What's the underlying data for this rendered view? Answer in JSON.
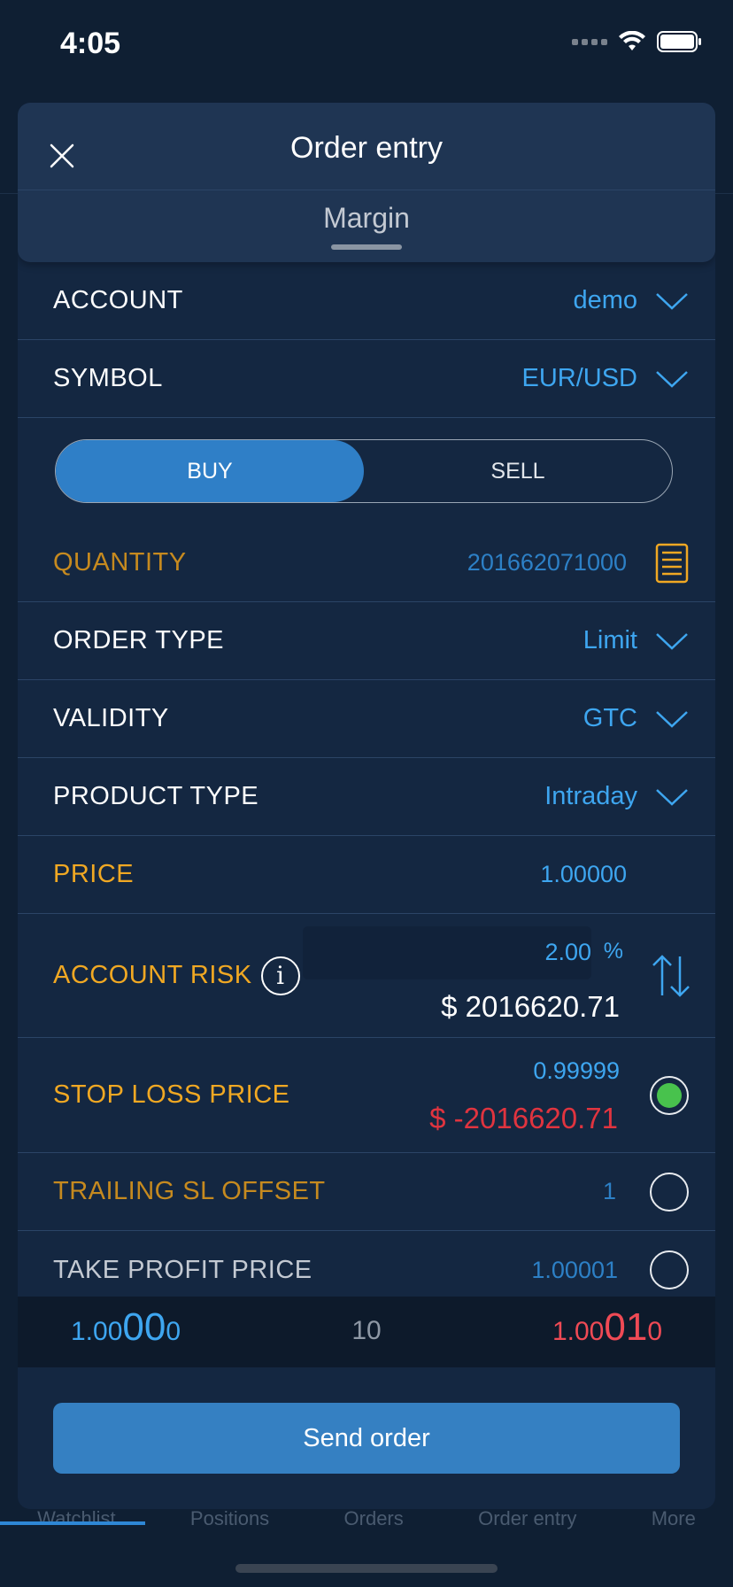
{
  "status": {
    "time": "4:05"
  },
  "background_tabs": [
    "Watchlist",
    "Positions",
    "Orders",
    "Order entry",
    "More"
  ],
  "header": {
    "title": "Order entry",
    "subtitle_tab": "Margin"
  },
  "account": {
    "label": "ACCOUNT",
    "value": "demo"
  },
  "symbol": {
    "label": "SYMBOL",
    "value": "EUR/USD"
  },
  "side": {
    "buy": "BUY",
    "sell": "SELL",
    "selected": "BUY"
  },
  "quantity": {
    "label": "QUANTITY",
    "value": "201662071000"
  },
  "order_type": {
    "label": "ORDER TYPE",
    "value": "Limit"
  },
  "validity": {
    "label": "VALIDITY",
    "value": "GTC"
  },
  "product_type": {
    "label": "PRODUCT TYPE",
    "value": "Intraday"
  },
  "price": {
    "label": "PRICE",
    "value": "1.00000"
  },
  "account_risk": {
    "label": "ACCOUNT RISK",
    "info": "i",
    "percent": "2.00",
    "percent_unit": "%",
    "amount": "$ 2016620.71"
  },
  "stop_loss": {
    "label": "STOP LOSS PRICE",
    "price": "0.99999",
    "amount": "$ -2016620.71",
    "selected": true
  },
  "trailing_sl": {
    "label": "TRAILING SL OFFSET",
    "value": "1"
  },
  "take_profit": {
    "label": "TAKE PROFIT PRICE",
    "value": "1.00001"
  },
  "quote": {
    "bid_prefix": "1.00",
    "bid_big": "00",
    "bid_suffix": "0",
    "spread": "10",
    "ask_prefix": "1.00",
    "ask_big": "01",
    "ask_suffix": "0"
  },
  "send_button": "Send order",
  "colors": {
    "accent": "#2f7fc7",
    "gold": "#f0a823",
    "negative": "#e0343f",
    "value_blue": "#3ea6f0",
    "radio_on": "#48c24d"
  }
}
